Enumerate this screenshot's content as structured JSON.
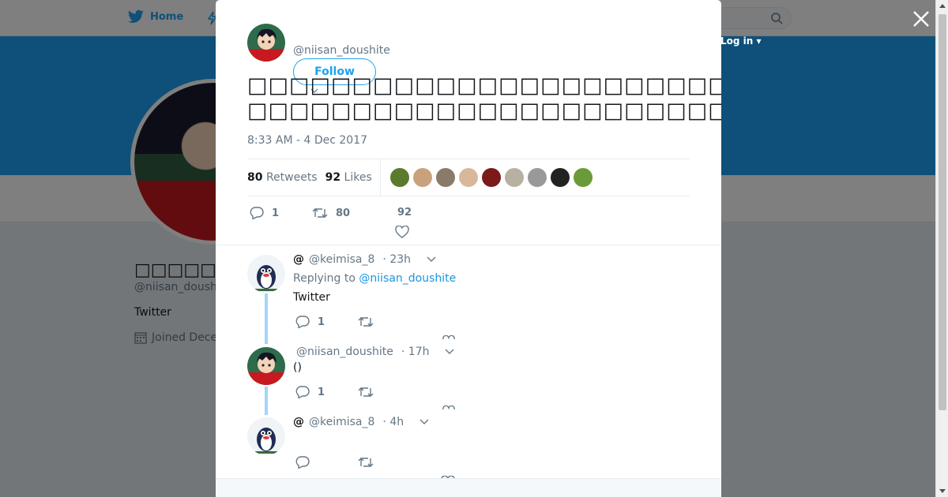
{
  "background": {
    "nav": {
      "home_label": "Home",
      "login_label": "Log in"
    },
    "profile": {
      "name": "□□□□□",
      "handle": "@niisan_doushite",
      "bio": "Twitter",
      "joined": "Joined Dece"
    }
  },
  "modal": {
    "tweet": {
      "handle": "@niisan_doushite",
      "follow_label": "Follow",
      "text_line1": "□□□□□□□□□□□□□□□□□□□□□□□□□□□□□□□",
      "text_line2": "□□□□□□□□□□□□□□□□□□□□□□□□□□□□□□□□□□□",
      "timestamp": "8:33 AM - 4 Dec 2017",
      "retweets_count": "80",
      "retweets_label": "Retweets",
      "likes_count": "92",
      "likes_label": "Likes",
      "liker_colors": [
        "#5a7a2e",
        "#c9a27d",
        "#8a7a6a",
        "#d9b89a",
        "#7a1a1a",
        "#b8b0a0",
        "#999999",
        "#222222",
        "#6a9a3a"
      ],
      "actions": {
        "reply_count": "1",
        "retweet_count": "80",
        "like_count": "92"
      }
    },
    "replies": [
      {
        "name": "@",
        "handle": "@keimisa_8",
        "time": "· 23h",
        "replying_prefix": "Replying to",
        "replying_to": "@niisan_doushite",
        "text": "Twitter",
        "reply_count": "1"
      },
      {
        "handle": "@niisan_doushite",
        "time": "· 17h",
        "text": "()",
        "reply_count": "1"
      },
      {
        "name": "@",
        "handle": "@keimisa_8",
        "time": "· 4h",
        "text": ""
      }
    ]
  }
}
